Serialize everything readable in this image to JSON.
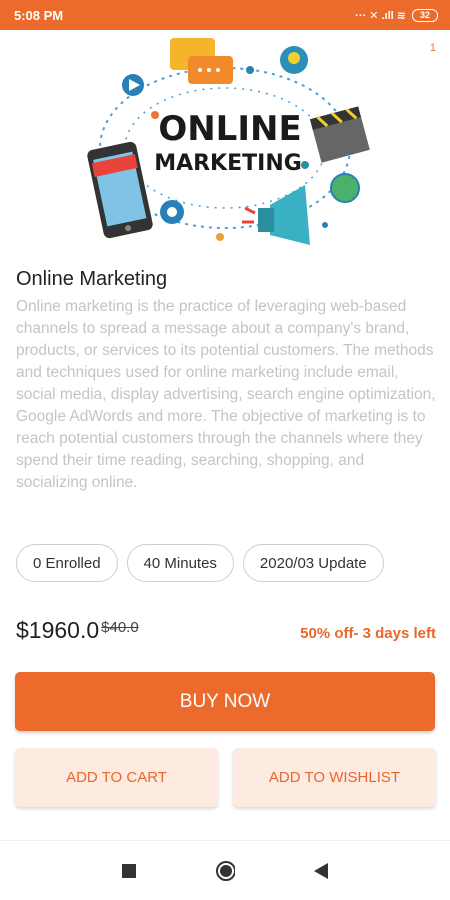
{
  "status_bar": {
    "time": "5:08 PM",
    "indicators": "··· ✕ .ıll ≋",
    "battery": "32"
  },
  "hero": {
    "page_indicator": "1",
    "art_title_line1": "ONLINE",
    "art_title_line2": "MARKETING"
  },
  "course": {
    "title": "Online Marketing",
    "description": "Online marketing is the practice of leveraging web-based channels to spread a message about a company's brand, products, or services to its potential customers. The methods and techniques used for online marketing include email, social media, display advertising, search engine optimization, Google AdWords and more. The objective of marketing is to reach potential customers through the channels where they spend their time reading, searching, shopping, and socializing online."
  },
  "chips": {
    "enrolled": "0 Enrolled",
    "duration": "40 Minutes",
    "updated": "2020/03 Update"
  },
  "pricing": {
    "price": "$1960.0",
    "old_price": "$40.0",
    "discount": "50% off- 3 days left"
  },
  "actions": {
    "buy": "BUY NOW",
    "cart": "ADD TO CART",
    "wishlist": "ADD TO WISHLIST"
  },
  "colors": {
    "accent": "#ec6a2c",
    "light_accent": "#fdeae0",
    "muted_text": "#c4c4c4"
  }
}
